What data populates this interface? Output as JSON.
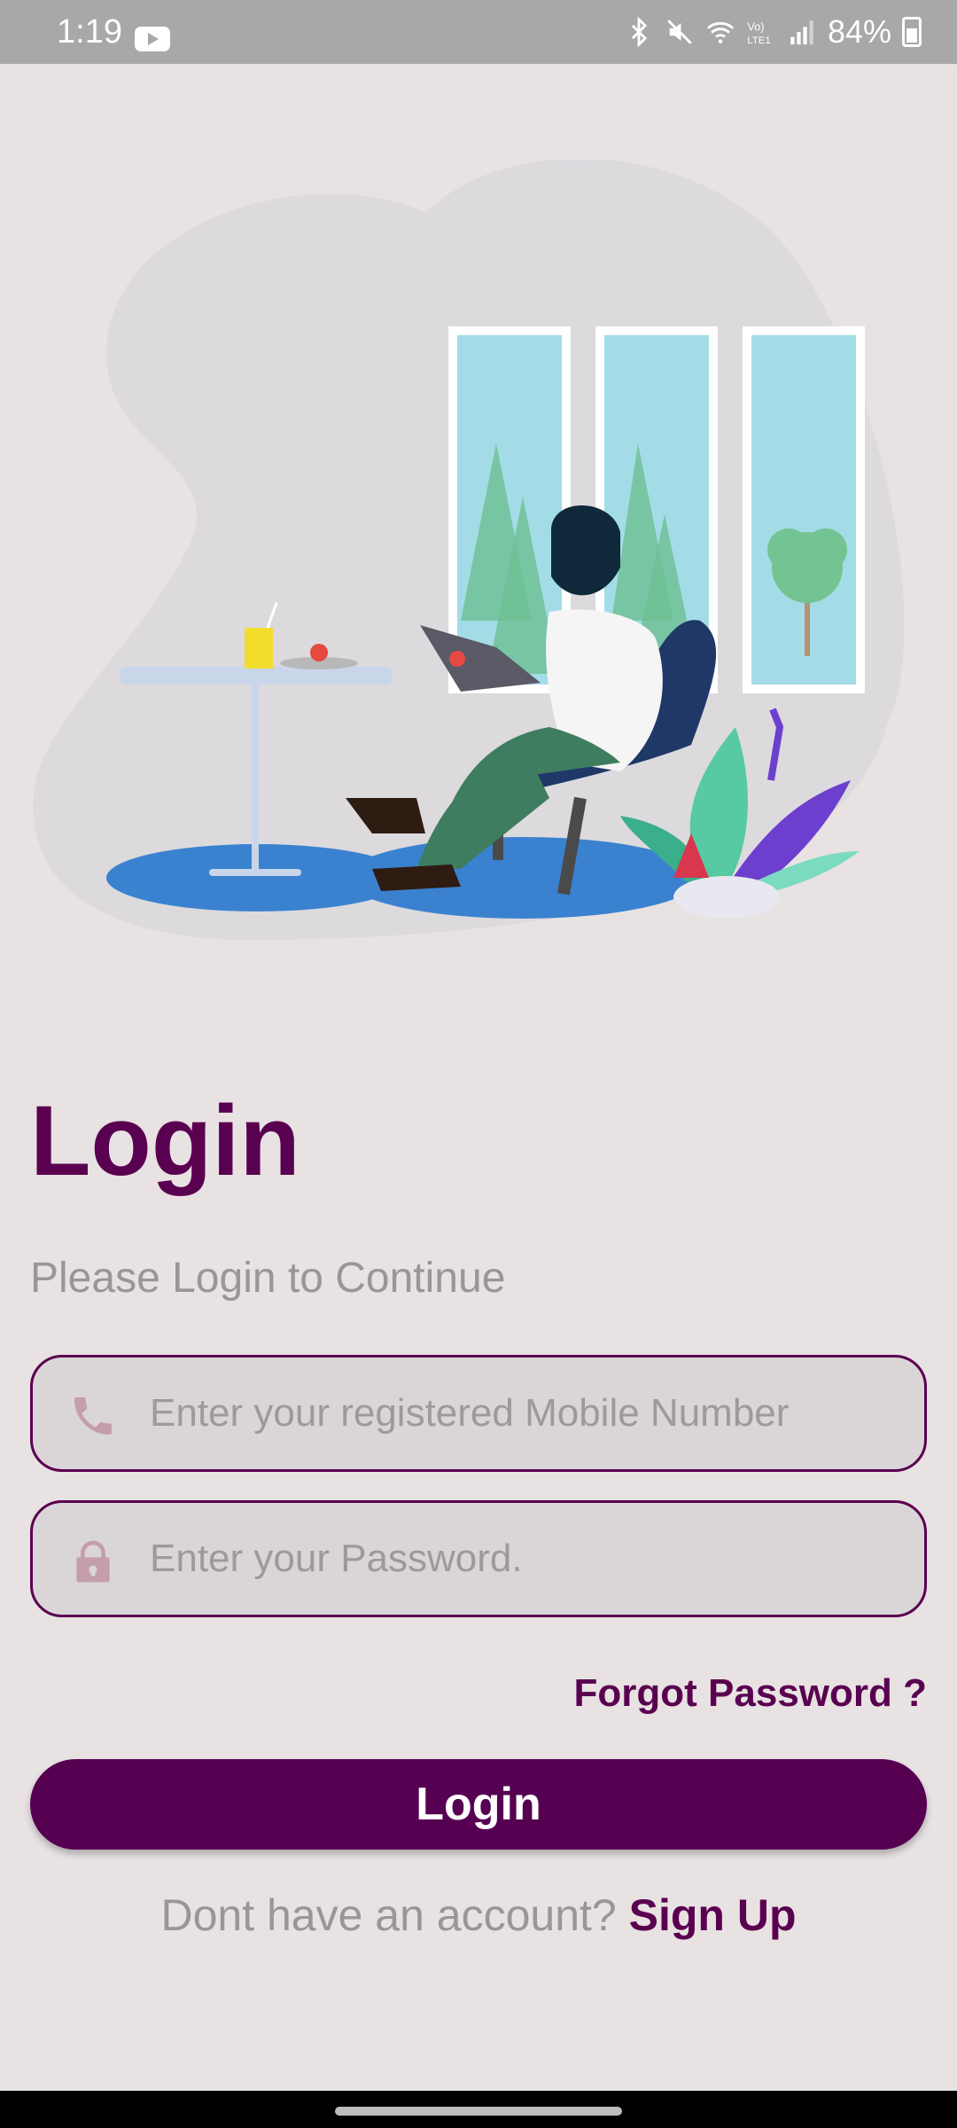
{
  "status_bar": {
    "time": "1:19",
    "battery": "84%",
    "icons": [
      "youtube-icon",
      "bluetooth-icon",
      "mute-icon",
      "wifi-icon",
      "volte-icon",
      "signal-icon",
      "battery-charging-icon"
    ]
  },
  "illustration": {
    "description_icon": "man-with-laptop-illustration",
    "colors": {
      "blob": "#DCDADD",
      "rug": "#3A82D0",
      "chair": "#1F3868",
      "window": "#A3DCE6"
    }
  },
  "login": {
    "title": "Login",
    "subtitle": "Please Login to Continue",
    "mobile_placeholder": "Enter your registered Mobile Number",
    "mobile_value": "",
    "password_placeholder": "Enter your Password.",
    "password_value": "",
    "forgot_label": "Forgot Password ?",
    "button_label": "Login",
    "signup_prompt": "Dont have an account?",
    "signup_label": "Sign Up"
  },
  "colors": {
    "brand": "#5A0050",
    "background": "#E8E2E3",
    "field_bg": "#DAD6D7",
    "icon_tint": "#C59EAE"
  }
}
